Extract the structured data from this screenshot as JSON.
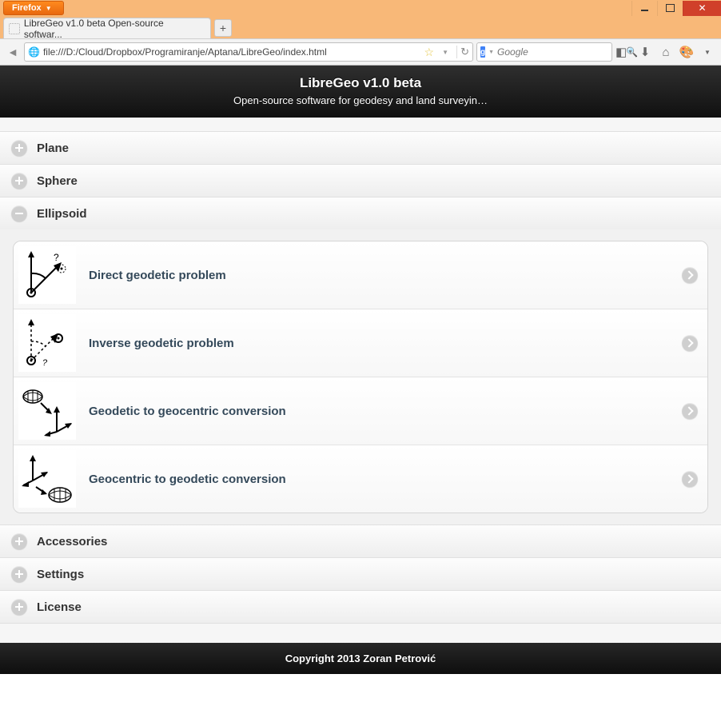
{
  "browser": {
    "name": "Firefox",
    "tab_title": "LibreGeo v1.0 beta Open-source softwar...",
    "url": "file:///D:/Cloud/Dropbox/Programiranje/Aptana/LibreGeo/index.html",
    "search_placeholder": "Google"
  },
  "page": {
    "title": "LibreGeo v1.0 beta",
    "subtitle": "Open-source software for geodesy and land surveyin…",
    "footer": "Copyright 2013 Zoran Petrović"
  },
  "accordion": {
    "plane": {
      "label": "Plane",
      "expanded": false
    },
    "sphere": {
      "label": "Sphere",
      "expanded": false
    },
    "ellipsoid": {
      "label": "Ellipsoid",
      "expanded": true,
      "items": [
        {
          "label": "Direct geodetic problem"
        },
        {
          "label": "Inverse geodetic problem"
        },
        {
          "label": "Geodetic to geocentric conversion"
        },
        {
          "label": "Geocentric to geodetic conversion"
        }
      ]
    },
    "accessories": {
      "label": "Accessories",
      "expanded": false
    },
    "settings": {
      "label": "Settings",
      "expanded": false
    },
    "license": {
      "label": "License",
      "expanded": false
    }
  }
}
